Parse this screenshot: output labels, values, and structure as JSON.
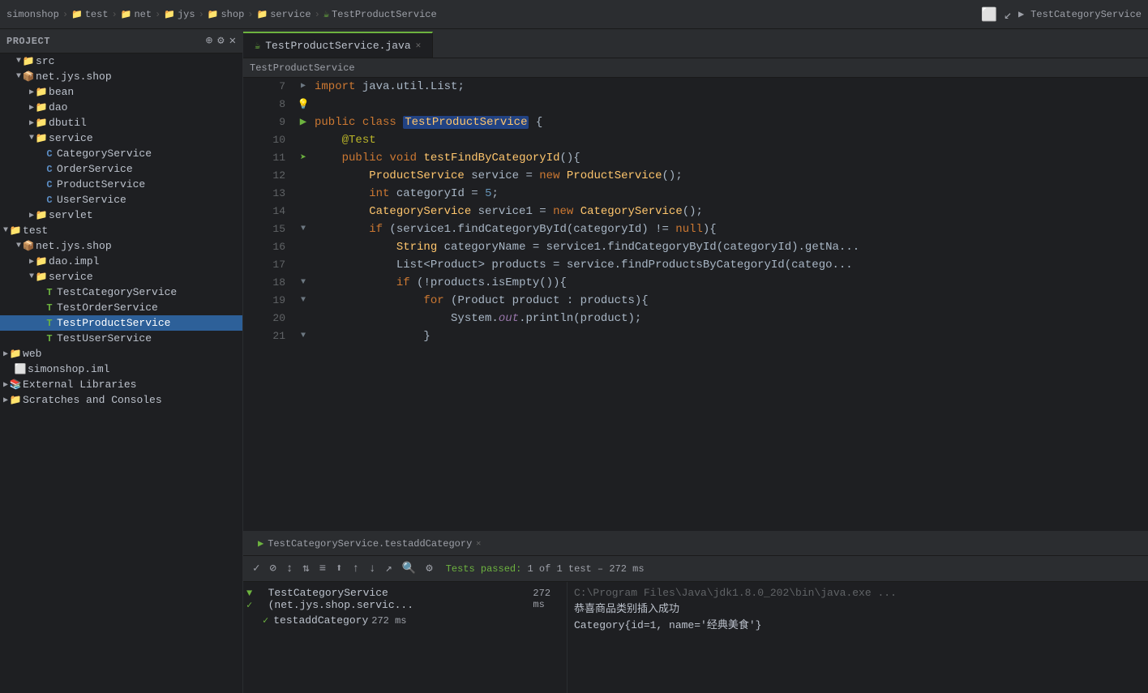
{
  "titleBar": {
    "breadcrumbs": [
      "simonshop",
      "test",
      "net",
      "jys",
      "shop",
      "service",
      "TestProductService"
    ],
    "rightLabel": "TestCategoryService"
  },
  "sidebar": {
    "title": "Project",
    "tree": [
      {
        "id": "src",
        "label": "src",
        "type": "folder",
        "level": 0,
        "open": true
      },
      {
        "id": "net.jys.shop",
        "label": "net.jys.shop",
        "type": "package",
        "level": 1,
        "open": true
      },
      {
        "id": "bean",
        "label": "bean",
        "type": "folder",
        "level": 2
      },
      {
        "id": "dao",
        "label": "dao",
        "type": "folder",
        "level": 2
      },
      {
        "id": "dbutil",
        "label": "dbutil",
        "type": "folder",
        "level": 2
      },
      {
        "id": "service",
        "label": "service",
        "type": "folder",
        "level": 2,
        "open": true
      },
      {
        "id": "CategoryService",
        "label": "CategoryService",
        "type": "java",
        "level": 3
      },
      {
        "id": "OrderService",
        "label": "OrderService",
        "type": "java",
        "level": 3
      },
      {
        "id": "ProductService",
        "label": "ProductService",
        "type": "java",
        "level": 3
      },
      {
        "id": "UserService",
        "label": "UserService",
        "type": "java",
        "level": 3
      },
      {
        "id": "servlet",
        "label": "servlet",
        "type": "folder",
        "level": 2
      },
      {
        "id": "test",
        "label": "test",
        "type": "folder-root",
        "level": 0,
        "open": true
      },
      {
        "id": "net.jys.shop2",
        "label": "net.jys.shop",
        "type": "package",
        "level": 1,
        "open": true
      },
      {
        "id": "dao.impl",
        "label": "dao.impl",
        "type": "folder",
        "level": 2
      },
      {
        "id": "service2",
        "label": "service",
        "type": "folder",
        "level": 2,
        "open": true
      },
      {
        "id": "TestCategoryService",
        "label": "TestCategoryService",
        "type": "java-test",
        "level": 3
      },
      {
        "id": "TestOrderService",
        "label": "TestOrderService",
        "type": "java-test",
        "level": 3
      },
      {
        "id": "TestProductService",
        "label": "TestProductService",
        "type": "java-test",
        "level": 3,
        "selected": true
      },
      {
        "id": "TestUserService",
        "label": "TestUserService",
        "type": "java-test",
        "level": 3
      },
      {
        "id": "web",
        "label": "web",
        "type": "folder",
        "level": 0
      },
      {
        "id": "simonshop.iml",
        "label": "simonshop.iml",
        "type": "iml",
        "level": 0
      },
      {
        "id": "ExternalLibraries",
        "label": "External Libraries",
        "type": "folder",
        "level": 0
      },
      {
        "id": "ScratchesAndConsoles",
        "label": "Scratches and Consoles",
        "type": "folder",
        "level": 0
      }
    ]
  },
  "tabs": [
    {
      "id": "TestProductService",
      "label": "TestProductService.java",
      "active": true,
      "icon": "java"
    }
  ],
  "editor": {
    "breadcrumb": "TestProductService",
    "lines": [
      {
        "num": 7,
        "gutter": "fold",
        "code": "import java.util.List;"
      },
      {
        "num": 8,
        "gutter": "",
        "code": ""
      },
      {
        "num": 9,
        "gutter": "run-arrow",
        "code": "public class TestProductService {",
        "highlight": false
      },
      {
        "num": 10,
        "gutter": "",
        "code": "    @Test"
      },
      {
        "num": 11,
        "gutter": "cursor",
        "code": "    public void testFindByCategoryId(){"
      },
      {
        "num": 12,
        "gutter": "",
        "code": "        ProductService service = new ProductService();"
      },
      {
        "num": 13,
        "gutter": "",
        "code": "        int categoryId = 5;"
      },
      {
        "num": 14,
        "gutter": "",
        "code": "        CategoryService service1 = new CategoryService();"
      },
      {
        "num": 15,
        "gutter": "fold",
        "code": "        if (service1.findCategoryById(categoryId) != null){"
      },
      {
        "num": 16,
        "gutter": "",
        "code": "            String categoryName = service1.findCategoryById(categoryId).getNa..."
      },
      {
        "num": 17,
        "gutter": "",
        "code": "            List<Product> products = service.findProductsByCategoryId(catego..."
      },
      {
        "num": 18,
        "gutter": "fold",
        "code": "            if (!products.isEmpty()){"
      },
      {
        "num": 19,
        "gutter": "fold",
        "code": "                for (Product product : products){"
      },
      {
        "num": 20,
        "gutter": "",
        "code": "                    System.out.println(product);"
      },
      {
        "num": 21,
        "gutter": "",
        "code": "                }"
      }
    ]
  },
  "bottomPanel": {
    "tabLabel": "TestCategoryService.testaddCategory ×",
    "toolbarStatus": "Tests passed: 1 of 1 test – 272 ms",
    "testTree": [
      {
        "label": "TestCategoryService (net.jys.shop.servic...",
        "duration": "272 ms",
        "status": "pass",
        "indent": 0
      },
      {
        "label": "testaddCategory",
        "duration": "272 ms",
        "status": "pass",
        "indent": 1
      }
    ],
    "consoleLines": [
      "C:\\Program Files\\Java\\jdk1.8.0_202\\bin\\java.exe ...",
      "恭喜商品类别插入成功",
      "Category{id=1, name='经典美食'}"
    ]
  }
}
